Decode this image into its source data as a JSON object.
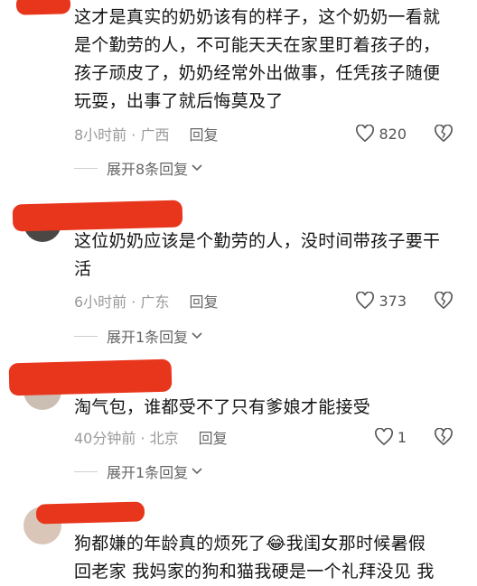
{
  "comments": [
    {
      "text_lines": [
        "这才是真实的奶奶该有的样子，这个奶奶一看就",
        "是个勤劳的人，不可能天天在家里盯着孩子的，",
        "孩子顽皮了，奶奶经常外出做事，任凭孩子随便",
        "玩耍，出事了就后悔莫及了"
      ],
      "time": "8小时前 · 广西",
      "reply": "回复",
      "likes": "820",
      "expand": "展开8条回复"
    },
    {
      "text_lines": [
        "这位奶奶应该是个勤劳的人，没时间带孩子要干",
        "活"
      ],
      "time": "6小时前 · 广东",
      "reply": "回复",
      "likes": "373",
      "expand": "展开1条回复"
    },
    {
      "text_lines": [
        "淘气包，谁都受不了只有爹娘才能接受"
      ],
      "time": "40分钟前 · 北京",
      "reply": "回复",
      "likes": "1",
      "expand": "展开1条回复"
    },
    {
      "text_lines": [
        "狗都嫌的年龄真的烦死了😂我闺女那时候暑假",
        "回老家 我妈家的狗和猫我硬是一个礼拜没见 我"
      ]
    }
  ],
  "colors": {
    "redaction": "#e8361d",
    "meta": "#9a9a9a",
    "text": "#151515"
  },
  "icons": {
    "like": "heart-outline-icon",
    "dislike": "broken-heart-icon",
    "expand": "chevron-down-icon"
  }
}
